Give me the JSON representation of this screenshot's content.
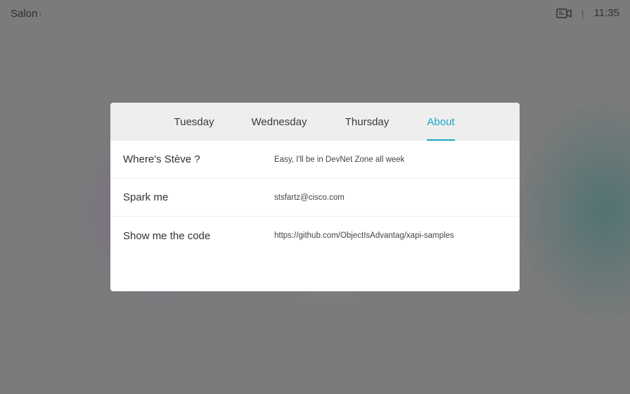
{
  "topbar": {
    "room_name": "Salon",
    "room_chevron": "›",
    "separator": "|",
    "time": "11:35",
    "camera_icon": "camera-icon"
  },
  "panel": {
    "tabs": [
      {
        "label": "Tuesday",
        "active": false
      },
      {
        "label": "Wednesday",
        "active": false
      },
      {
        "label": "Thursday",
        "active": false
      },
      {
        "label": "About",
        "active": true
      }
    ],
    "rows": [
      {
        "label": "Where's Stève ?",
        "value": "Easy, I'll be in DevNet Zone all week"
      },
      {
        "label": "Spark me",
        "value": "stsfartz@cisco.com"
      },
      {
        "label": "Show me the code",
        "value": "https://github.com/ObjectIsAdvantag/xapi-samples"
      }
    ]
  },
  "colors": {
    "accent": "#1ba6c7",
    "background": "#7b7b7b",
    "panel": "#ffffff",
    "tabbar": "#eeeeee"
  }
}
